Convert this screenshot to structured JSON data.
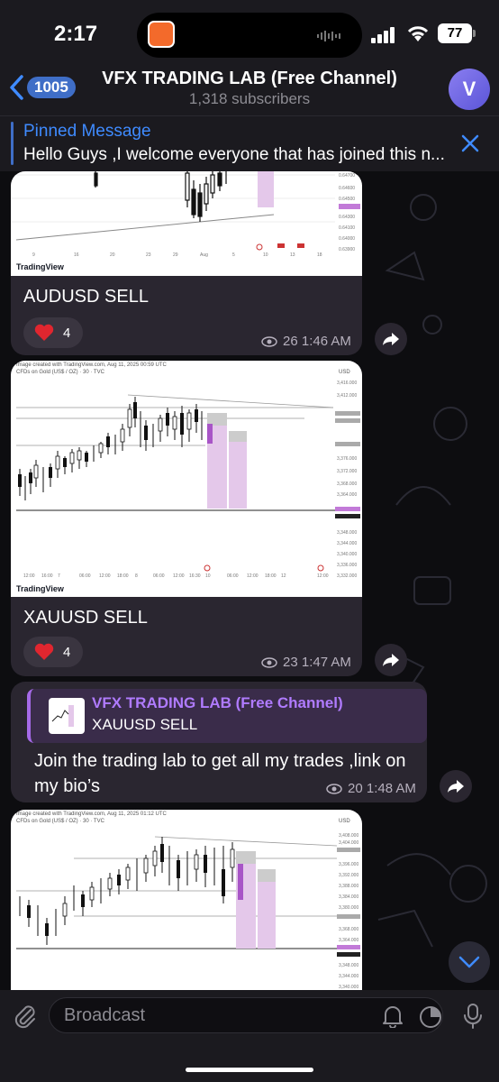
{
  "status_bar": {
    "time": "2:17",
    "battery": "77"
  },
  "header": {
    "back_count": "1005",
    "channel_title": "VFX TRADING LAB (Free Channel)",
    "subscribers": "1,318 subscribers",
    "avatar_letter": "V"
  },
  "pinned": {
    "title": "Pinned Message",
    "text": "Hello Guys ,I welcome everyone that has joined this n..."
  },
  "messages": [
    {
      "caption": "AUDUSD SELL",
      "reaction_count": "4",
      "views": "26",
      "time": "1:46 AM",
      "chart_brand": "TradingView"
    },
    {
      "caption": "XAUUSD SELL",
      "reaction_count": "4",
      "views": "23",
      "time": "1:47 AM",
      "chart_brand": "TradingView",
      "chart_header": "Image created with TradingView.com, Aug 11, 2025 00:59 UTC",
      "chart_sub": "CFDs on Gold (US$ / OZ) · 30 · TVC",
      "price_label": "USD"
    },
    {
      "forward_from": "VFX TRADING LAB (Free Channel)",
      "forward_text": "XAUUSD SELL",
      "text": "Join the trading lab to get all my trades  ,link on my bio’s",
      "views": "20",
      "time": "1:48 AM"
    },
    {
      "chart_header": "Image created with TradingView.com, Aug 11, 2025 01:12 UTC",
      "chart_sub": "CFDs on Gold (US$ / OZ) · 30 · TVC",
      "price_label": "USD"
    }
  ],
  "input": {
    "placeholder": "Broadcast"
  },
  "colors": {
    "accent": "#3f8bff",
    "bubble": "#2a2630",
    "reaction_heart": "#e0262f",
    "forward_name": "#b07bff"
  }
}
